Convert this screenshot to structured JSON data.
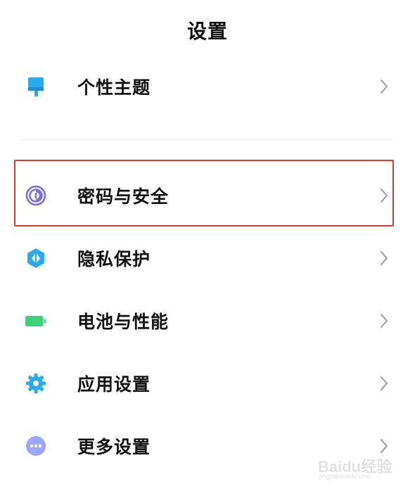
{
  "header": {
    "title": "设置"
  },
  "menu": [
    {
      "label": "个性主题",
      "icon": "brush-icon",
      "color": "#2aa9ee"
    },
    {
      "label": "密码与安全",
      "icon": "fingerprint-icon",
      "color": "#7a6fd4"
    },
    {
      "label": "隐私保护",
      "icon": "privacy-shield-icon",
      "color": "#2aa9ee"
    },
    {
      "label": "电池与性能",
      "icon": "battery-icon",
      "color": "#3ed07a"
    },
    {
      "label": "应用设置",
      "icon": "gear-icon",
      "color": "#2aa9ee"
    },
    {
      "label": "更多设置",
      "icon": "more-dots-icon",
      "color": "#9aa6ff"
    }
  ],
  "highlight_color": "#d9392f",
  "chevron": "chevron-right-icon",
  "watermark": {
    "text": "Baidu经验",
    "sub": "jingyan.baidu.com"
  }
}
